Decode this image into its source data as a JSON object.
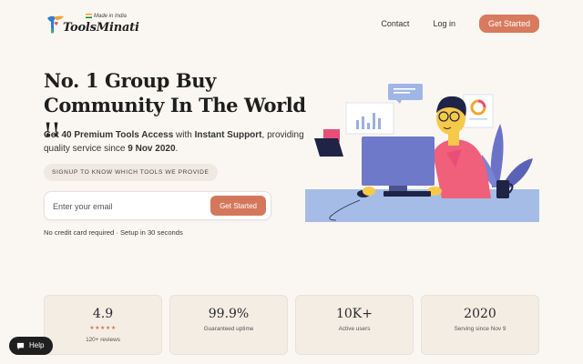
{
  "brand": {
    "name": "ToolsMinati",
    "tagline": "Made in India",
    "colors": {
      "accent": "#d87a5e",
      "background": "#faf7f2",
      "card": "#f4ede4"
    }
  },
  "nav": {
    "contact": "Contact",
    "login": "Log in",
    "cta": "Get Started"
  },
  "hero": {
    "title": "No. 1 Group Buy Community In The World !!",
    "sub_part1": "Get 40 Premium Tools Access",
    "sub_part2": " with ",
    "sub_part3": "Instant Support",
    "sub_part4": ", providing quality service since ",
    "sub_part5": "9 Nov 2020",
    "sub_part6": ".",
    "pill": "SIGNUP TO KNOW WHICH TOOLS WE PROVIDE",
    "email_placeholder": "Enter your email",
    "email_button": "Get Started",
    "note": "No credit card required · Setup in 30 seconds"
  },
  "stats": [
    {
      "value": "4.9",
      "stars": "★★★★★",
      "rating": 5,
      "label": "120+ reviews"
    },
    {
      "value": "99.9%",
      "label": "Guaranteed uptime"
    },
    {
      "value": "10K+",
      "label": "Active users"
    },
    {
      "value": "2020",
      "label": "Serving since Nov 9"
    }
  ],
  "help": {
    "label": "Help",
    "icon": "chat-bubble-icon"
  }
}
